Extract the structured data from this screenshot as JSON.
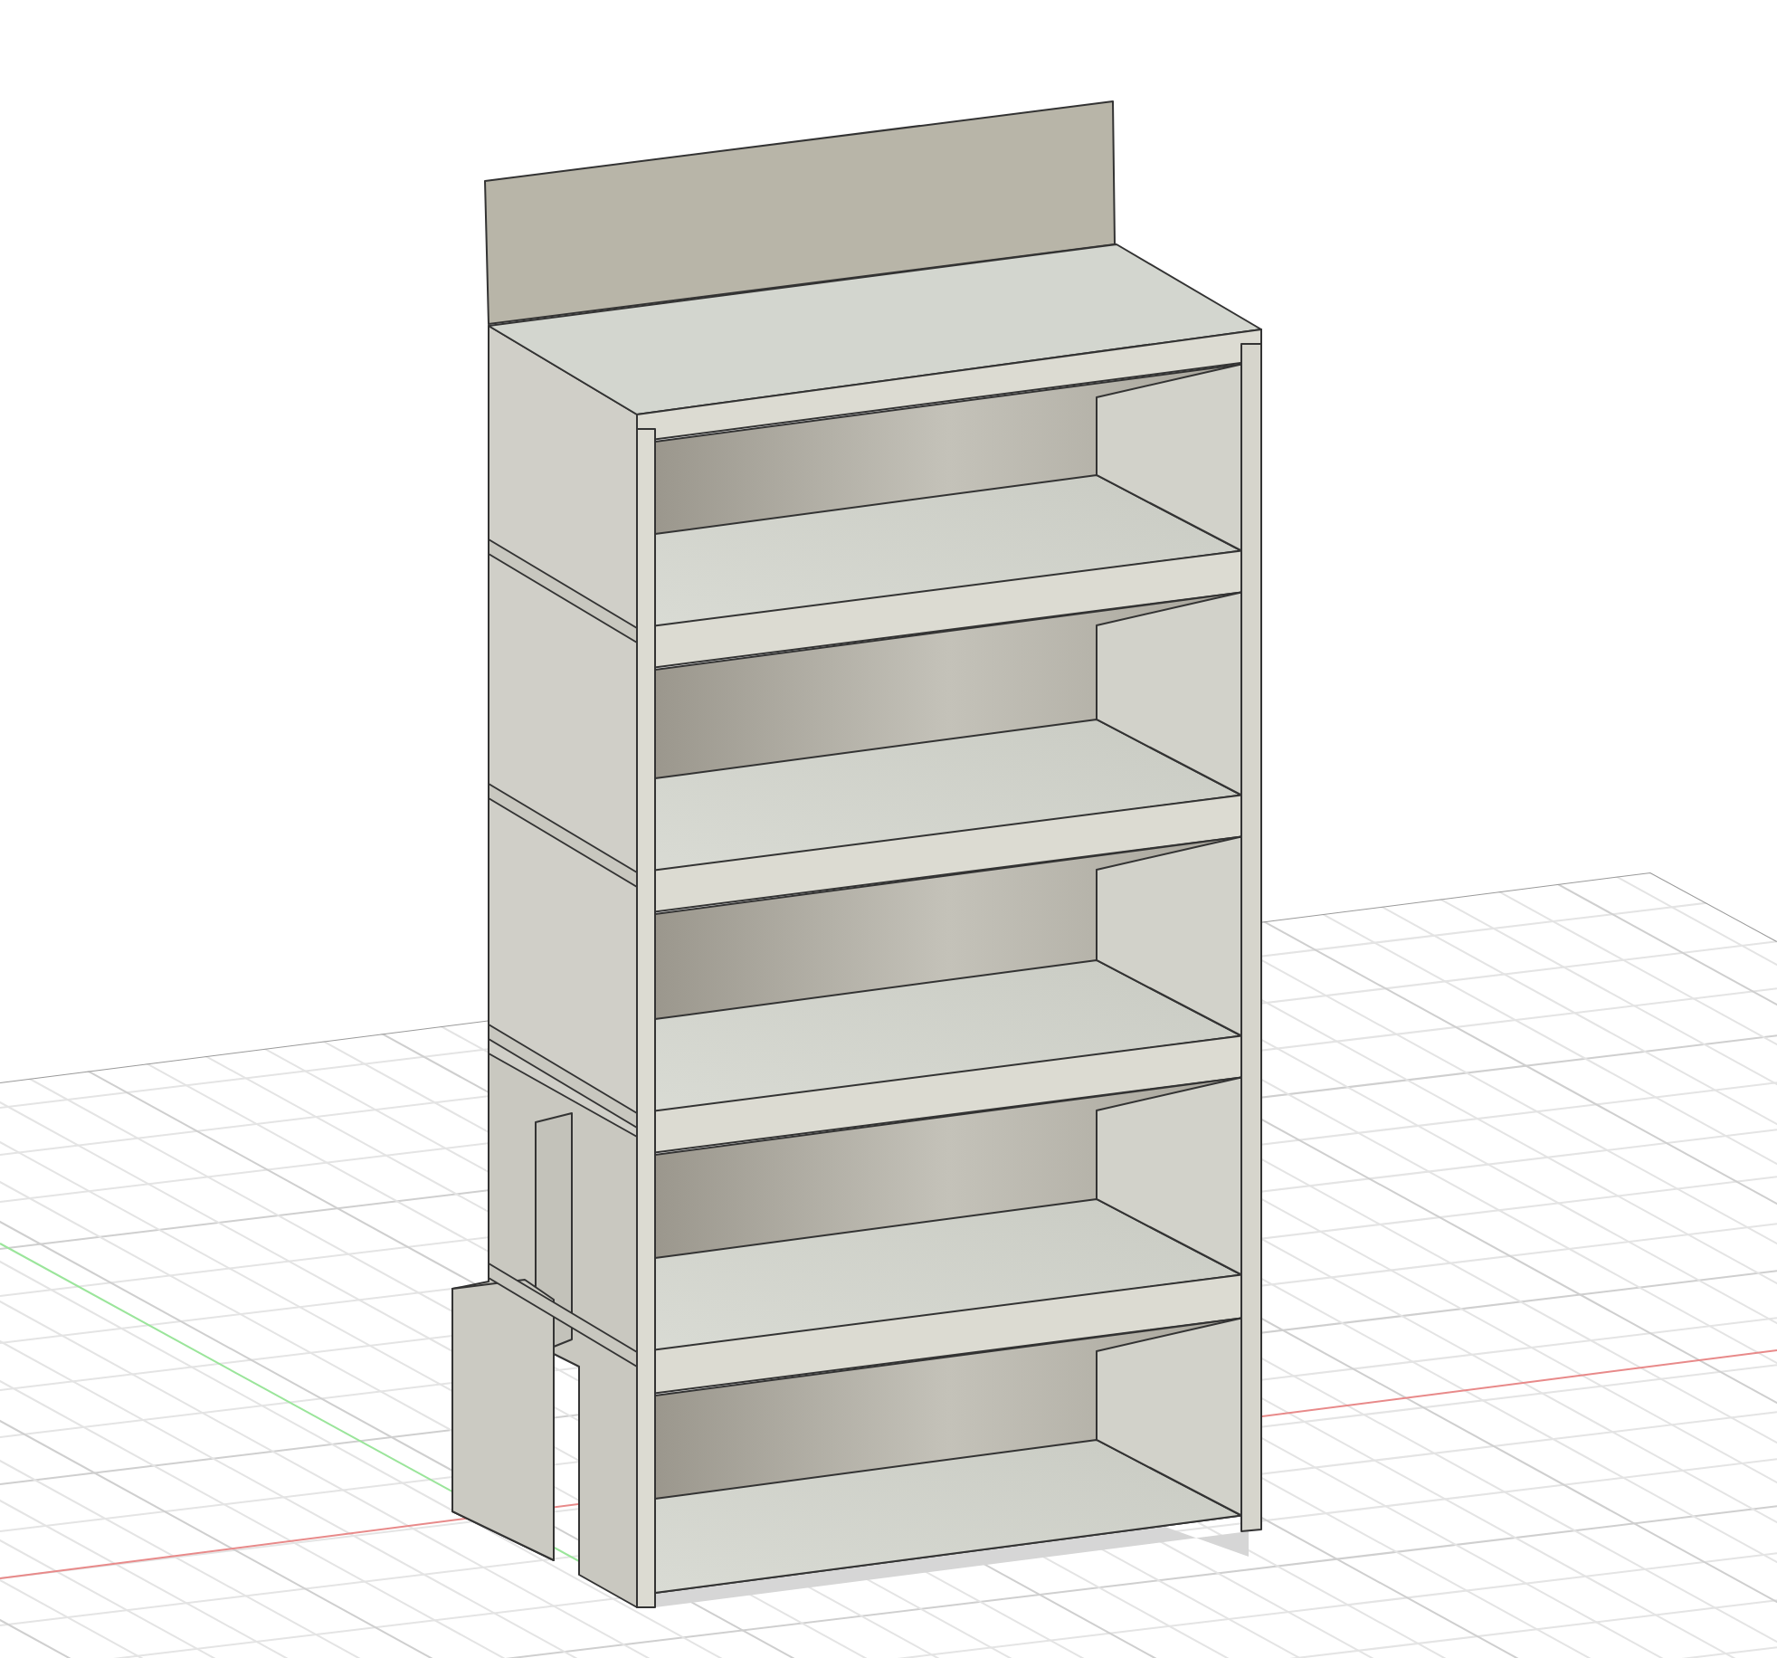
{
  "viewport": {
    "grid_visible": true,
    "axes_visible": true,
    "ground_shadow_visible": true
  }
}
